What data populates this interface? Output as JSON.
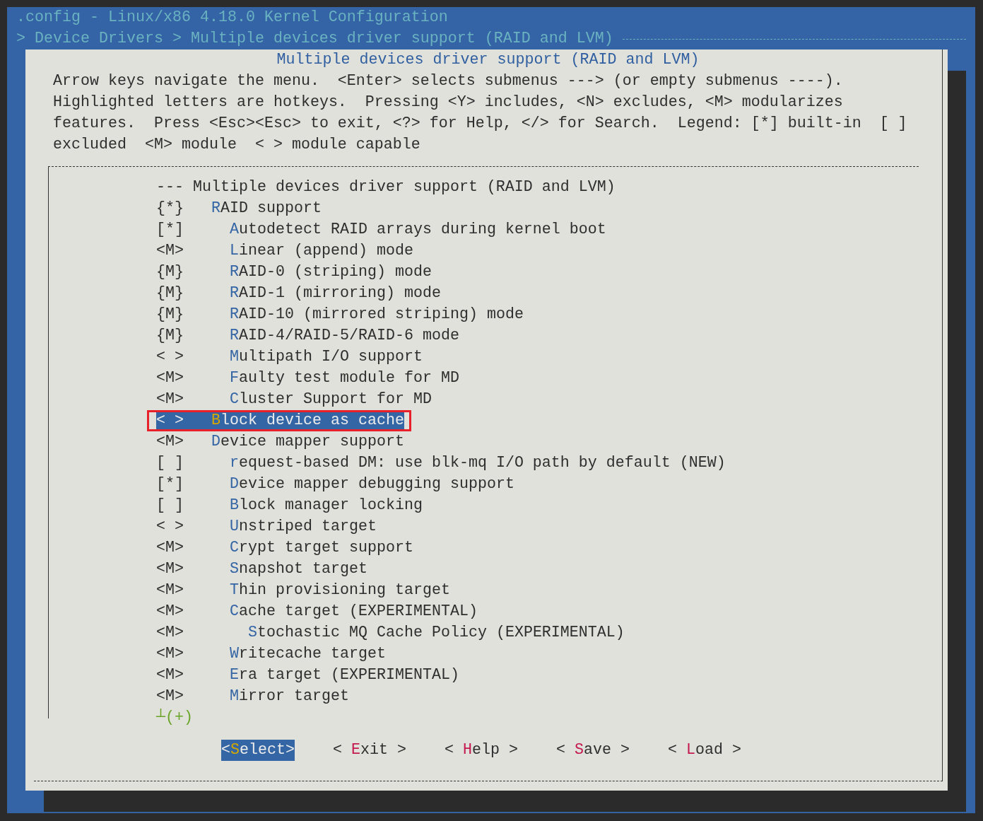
{
  "window": {
    "title": ".config - Linux/x86 4.18.0 Kernel Configuration"
  },
  "breadcrumb": "> Device Drivers > Multiple devices driver support (RAID and LVM)",
  "dialog": {
    "title": "Multiple devices driver support (RAID and LVM)",
    "help_lines": [
      "Arrow keys navigate the menu.  <Enter> selects submenus ---> (or empty submenus ----).",
      "Highlighted letters are hotkeys.  Pressing <Y> includes, <N> excludes, <M> modularizes",
      "features.  Press <Esc><Esc> to exit, <?> for Help, </> for Search.  Legend: [*] built-in  [ ]",
      "excluded  <M> module  < > module capable"
    ]
  },
  "menu": {
    "items": [
      {
        "kind": "comment",
        "prefix": "---",
        "label": "Multiple devices driver support (RAID and LVM)",
        "selected": false
      },
      {
        "kind": "option",
        "prefix": "{*}",
        "label": "RAID support",
        "selected": false,
        "children": [
          {
            "kind": "option",
            "prefix": "[*]",
            "label": "Autodetect RAID arrays during kernel boot",
            "selected": false
          },
          {
            "kind": "option",
            "prefix": "<M>",
            "label": "Linear (append) mode",
            "selected": false
          },
          {
            "kind": "option",
            "prefix": "{M}",
            "label": "RAID-0 (striping) mode",
            "selected": false
          },
          {
            "kind": "option",
            "prefix": "{M}",
            "label": "RAID-1 (mirroring) mode",
            "selected": false
          },
          {
            "kind": "option",
            "prefix": "{M}",
            "label": "RAID-10 (mirrored striping) mode",
            "selected": false
          },
          {
            "kind": "option",
            "prefix": "{M}",
            "label": "RAID-4/RAID-5/RAID-6 mode",
            "selected": false
          },
          {
            "kind": "option",
            "prefix": "< >",
            "label": "Multipath I/O support",
            "selected": false
          },
          {
            "kind": "option",
            "prefix": "<M>",
            "label": "Faulty test module for MD",
            "selected": false
          },
          {
            "kind": "option",
            "prefix": "<M>",
            "label": "Cluster Support for MD",
            "selected": false
          }
        ]
      },
      {
        "kind": "option",
        "prefix": "< >",
        "label": "Block device as cache",
        "selected": true,
        "marked": true
      },
      {
        "kind": "option",
        "prefix": "<M>",
        "label": "Device mapper support",
        "selected": false,
        "children": [
          {
            "kind": "option",
            "prefix": "[ ]",
            "label": "request-based DM: use blk-mq I/O path by default (NEW)",
            "selected": false
          },
          {
            "kind": "option",
            "prefix": "[*]",
            "label": "Device mapper debugging support",
            "selected": false
          },
          {
            "kind": "option",
            "prefix": "[ ]",
            "label": "Block manager locking",
            "selected": false
          },
          {
            "kind": "option",
            "prefix": "< >",
            "label": "Unstriped target",
            "selected": false
          },
          {
            "kind": "option",
            "prefix": "<M>",
            "label": "Crypt target support",
            "selected": false
          },
          {
            "kind": "option",
            "prefix": "<M>",
            "label": "Snapshot target",
            "selected": false
          },
          {
            "kind": "option",
            "prefix": "<M>",
            "label": "Thin provisioning target",
            "selected": false
          },
          {
            "kind": "option",
            "prefix": "<M>",
            "label": "Cache target (EXPERIMENTAL)",
            "selected": false,
            "children": [
              {
                "kind": "option",
                "prefix": "<M>",
                "label": "Stochastic MQ Cache Policy (EXPERIMENTAL)",
                "selected": false
              }
            ]
          },
          {
            "kind": "option",
            "prefix": "<M>",
            "label": "Writecache target",
            "selected": false
          },
          {
            "kind": "option",
            "prefix": "<M>",
            "label": "Era target (EXPERIMENTAL)",
            "selected": false
          },
          {
            "kind": "option",
            "prefix": "<M>",
            "label": "Mirror target",
            "selected": false
          }
        ]
      }
    ],
    "more_indicator": "┴(+)"
  },
  "buttons": [
    {
      "label": "<Select>",
      "selected": true
    },
    {
      "label": "< Exit >",
      "selected": false
    },
    {
      "label": "< Help >",
      "selected": false
    },
    {
      "label": "< Save >",
      "selected": false
    },
    {
      "label": "< Load >",
      "selected": false
    }
  ]
}
